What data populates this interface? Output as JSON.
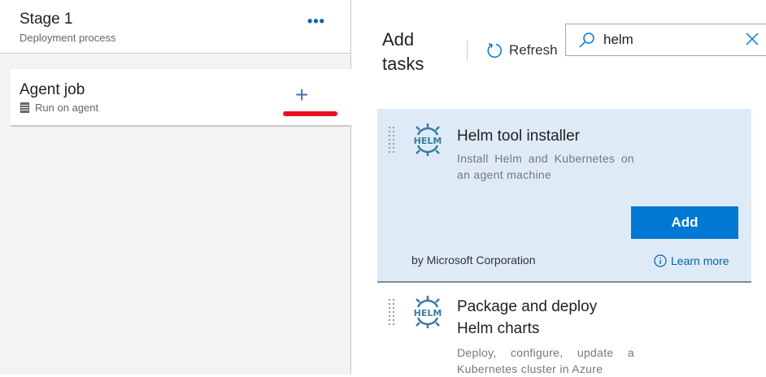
{
  "stage": {
    "title": "Stage 1",
    "subtitle": "Deployment process",
    "more_label": "•••"
  },
  "job": {
    "title": "Agent job",
    "subtitle": "Run on agent",
    "add_label": "+"
  },
  "panel": {
    "title": "Add tasks",
    "refresh_label": "Refresh"
  },
  "search": {
    "value": "helm"
  },
  "tasks": [
    {
      "title": "Helm tool installer",
      "description": "Install Helm and Kubernetes on an agent machine",
      "add_label": "Add",
      "publisher": "by Microsoft Corporation",
      "learn_more": "Learn more",
      "logo_text": "HELM"
    },
    {
      "title": "Package and deploy Helm charts",
      "description": "Deploy, configure, update a Kubernetes cluster in Azure",
      "logo_text": "HELM"
    }
  ],
  "colors": {
    "accent": "#0078d4",
    "selected": "#deebf7",
    "highlight": "#e81123"
  }
}
